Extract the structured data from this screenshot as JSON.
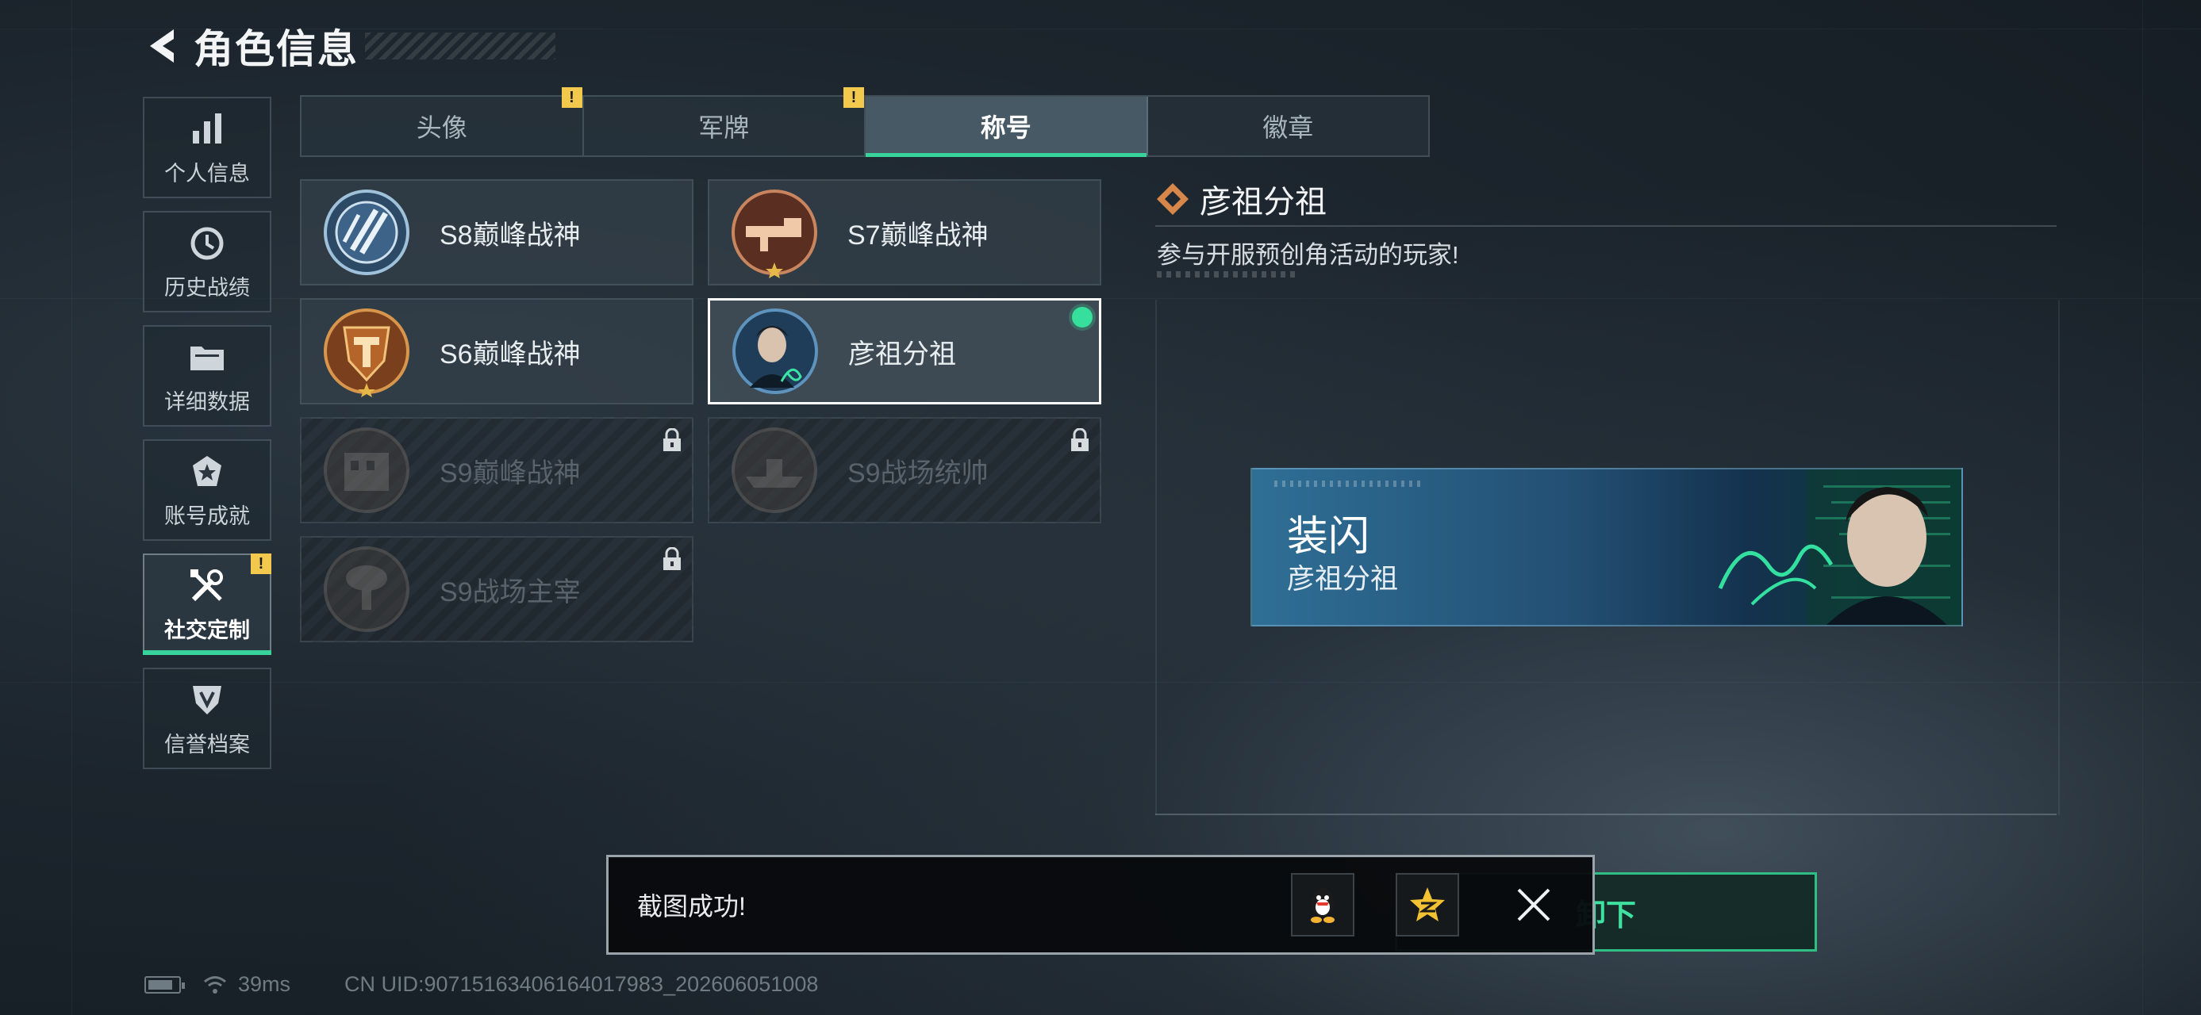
{
  "header": {
    "title": "角色信息"
  },
  "sidebar": {
    "items": [
      {
        "label": "个人信息",
        "icon": "bar-chart-icon"
      },
      {
        "label": "历史战绩",
        "icon": "history-clock-icon"
      },
      {
        "label": "详细数据",
        "icon": "folder-icon"
      },
      {
        "label": "账号成就",
        "icon": "achievement-icon"
      },
      {
        "label": "社交定制",
        "icon": "tools-icon",
        "active": true,
        "alert": "!"
      },
      {
        "label": "信誉档案",
        "icon": "shield-icon"
      }
    ]
  },
  "tabs": [
    {
      "label": "头像",
      "alert": "!"
    },
    {
      "label": "军牌",
      "alert": "!"
    },
    {
      "label": "称号",
      "active": true
    },
    {
      "label": "徽章"
    }
  ],
  "titles": [
    {
      "name": "S8巅峰战神",
      "state": "owned"
    },
    {
      "name": "S7巅峰战神",
      "state": "owned"
    },
    {
      "name": "S6巅峰战神",
      "state": "owned"
    },
    {
      "name": "彦祖分祖",
      "state": "equipped"
    },
    {
      "name": "S9巅峰战神",
      "state": "locked"
    },
    {
      "name": "S9战场统帅",
      "state": "locked"
    },
    {
      "name": "S9战场主宰",
      "state": "locked"
    }
  ],
  "detail": {
    "name": "彦祖分祖",
    "description": "参与开服预创角活动的玩家!",
    "banner_big": "装闪",
    "banner_small": "彦祖分祖",
    "unequip_label": "卸下"
  },
  "toast": {
    "message": "截图成功!",
    "share_qq_icon": "qq-penguin-icon",
    "share_qzone_icon": "qzone-star-icon"
  },
  "status": {
    "ping": "39ms",
    "uid": "CN UID:9071516340616401798З_202606051008"
  },
  "colors": {
    "accent": "#38d39a",
    "alert": "#f2c94c",
    "equipped_dot": "#36e09c"
  }
}
